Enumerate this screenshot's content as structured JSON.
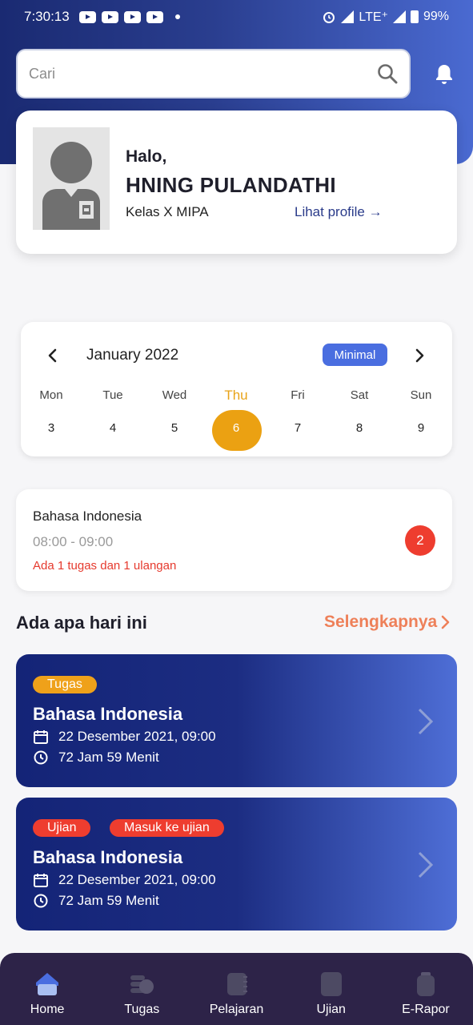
{
  "statusbar": {
    "time": "7:30:13",
    "network": "LTE⁺",
    "battery": "99%"
  },
  "search": {
    "placeholder": "Cari"
  },
  "profile": {
    "greeting": "Halo,",
    "name": "HNING PULANDATHI",
    "class": "Kelas X MIPA",
    "link": "Lihat profile"
  },
  "calendar": {
    "month": "January 2022",
    "toggle": "Minimal",
    "days": [
      {
        "day": "Mon",
        "date": "3"
      },
      {
        "day": "Tue",
        "date": "4"
      },
      {
        "day": "Wed",
        "date": "5"
      },
      {
        "day": "Thu",
        "date": "6"
      },
      {
        "day": "Fri",
        "date": "7"
      },
      {
        "day": "Sat",
        "date": "8"
      },
      {
        "day": "Sun",
        "date": "9"
      }
    ],
    "selected_index": 3
  },
  "schedule": {
    "subject": "Bahasa Indonesia",
    "time": "08:00 - 09:00",
    "note": "Ada 1 tugas dan 1 ulangan",
    "badge": "2"
  },
  "section": {
    "title": "Ada apa hari ini",
    "more": "Selengkapnya"
  },
  "tasks": [
    {
      "tags": [
        "Tugas"
      ],
      "title": "Bahasa Indonesia",
      "date": "22 Desember 2021, 09:00",
      "duration": "72 Jam 59 Menit"
    },
    {
      "tags": [
        "Ujian",
        "Masuk ke ujian"
      ],
      "title": "Bahasa Indonesia",
      "date": "22 Desember 2021, 09:00",
      "duration": "72 Jam 59 Menit"
    }
  ],
  "nav": [
    {
      "label": "Home",
      "icon": "home-icon",
      "active": true
    },
    {
      "label": "Tugas",
      "icon": "tasks-icon"
    },
    {
      "label": "Pelajaran",
      "icon": "book-icon"
    },
    {
      "label": "Ujian",
      "icon": "exam-icon"
    },
    {
      "label": "E-Rapor",
      "icon": "report-icon"
    }
  ],
  "colors": {
    "accent": "#4a6ee0",
    "highlight": "#eba112",
    "alert": "#ee3d2f",
    "header": "#1a2a72"
  }
}
